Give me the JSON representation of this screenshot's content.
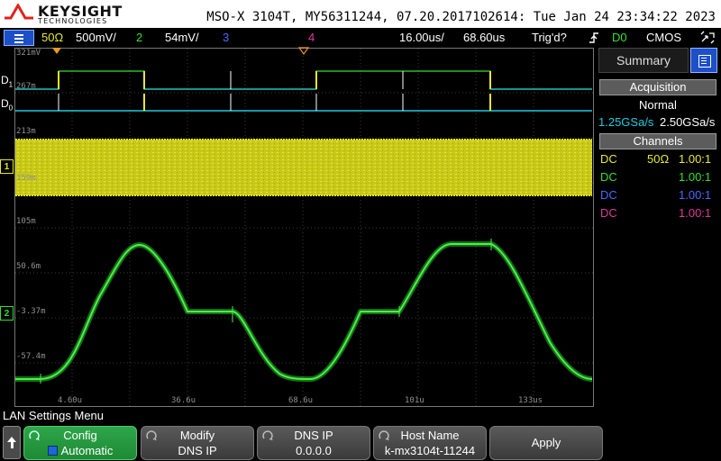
{
  "header": {
    "brand": "KEYSIGHT",
    "brand_sub": "TECHNOLOGIES",
    "instrument": "MSO-X 3104T, MY56311244, 07.20.2017102614: Tue Jan 24 23:34:22 2023"
  },
  "channel_bar": {
    "ch1_impedance": "50Ω",
    "ch1_scale": "500mV/",
    "ch2_label": "2",
    "ch2_scale": "54mV/",
    "ch3_label": "3",
    "ch4_label": "4",
    "timebase": "16.00us/",
    "delay": "68.60us",
    "trigger_status": "Trig'd?",
    "trigger_source": "D0",
    "trigger_type": "CMOS"
  },
  "display": {
    "digital_labels": [
      {
        "name": "D",
        "sub": "1"
      },
      {
        "name": "D",
        "sub": "0"
      }
    ],
    "y_labels": [
      "321mV",
      "267m",
      "213m",
      "159m",
      "105m",
      "50.6m",
      "-3.37m",
      "-57.4m"
    ],
    "x_labels": [
      "4.60u",
      "36.6u",
      "68.6u",
      "101u",
      "133us"
    ],
    "ch1_marker": "1",
    "ch2_marker": "2"
  },
  "panel": {
    "tab_label": "Summary",
    "acq_header": "Acquisition",
    "acq_mode": "Normal",
    "sample_rate_1": "1.25GSa/s",
    "sample_rate_2": "2.50GSa/s",
    "channels_header": "Channels",
    "channels": [
      {
        "coupling": "DC",
        "impedance": "50Ω",
        "probe": "1.00:1",
        "color": "#e8e82a"
      },
      {
        "coupling": "DC",
        "impedance": "",
        "probe": "1.00:1",
        "color": "#32e032"
      },
      {
        "coupling": "DC",
        "impedance": "",
        "probe": "1.00:1",
        "color": "#4a68ff"
      },
      {
        "coupling": "DC",
        "impedance": "",
        "probe": "1.00:1",
        "color": "#e0389a"
      }
    ]
  },
  "softkeys": {
    "menu_title": "LAN Settings Menu",
    "config_label": "Config",
    "config_value": "Automatic",
    "modify_label": "Modify",
    "modify_value": "DNS IP",
    "dns_label": "DNS IP",
    "dns_value": "0.0.0.0",
    "host_label": "Host Name",
    "host_value": "k-mx3104t-11244",
    "apply_label": "Apply"
  },
  "colors": {
    "ch1": "#e8e82a",
    "ch2": "#32e032",
    "ch3": "#4a68ff",
    "ch4": "#e0389a",
    "digital_high": "#32e032",
    "digital_low": "#1ecbe0",
    "accent": "#1c4fc8"
  },
  "icons": [
    "menu-icon",
    "trigger-edge-icon",
    "touch-icon",
    "summary-icon",
    "up-arrow-icon",
    "knob-icon"
  ]
}
